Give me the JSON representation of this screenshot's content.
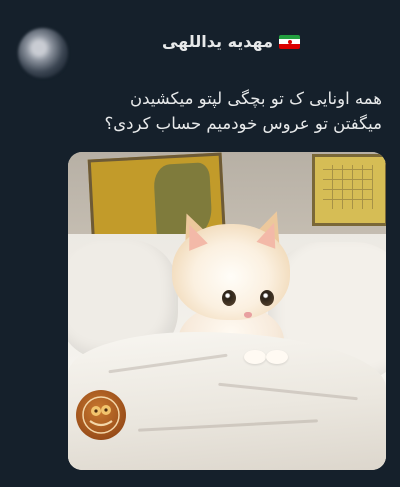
{
  "tweet": {
    "author_name": "مهدیه یداللهی",
    "author_flag_icon": "iran-flag-icon",
    "text_lines": [
      "همه اونایی ک تو بچگی لپتو میکشیدن",
      "میگفتن تو عروس خودمیم حساب کردی؟"
    ]
  },
  "media": {
    "image_icon": "kitten-photo",
    "watermark_icon": "cartoon-logo-badge"
  },
  "colors": {
    "background": "#15202b",
    "text": "#e7e9ea"
  }
}
